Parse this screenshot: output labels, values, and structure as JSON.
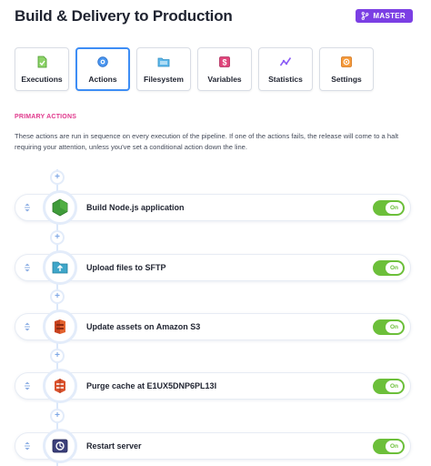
{
  "header": {
    "title": "Build & Delivery to Production",
    "branch_badge": "MASTER",
    "badge_color": "#7b3fe4"
  },
  "tabs": [
    {
      "label": "Executions",
      "icon": "executions-icon",
      "active": false
    },
    {
      "label": "Actions",
      "icon": "actions-gear-icon",
      "active": true
    },
    {
      "label": "Filesystem",
      "icon": "filesystem-icon",
      "active": false
    },
    {
      "label": "Variables",
      "icon": "variables-icon",
      "active": false
    },
    {
      "label": "Statistics",
      "icon": "statistics-icon",
      "active": false
    },
    {
      "label": "Settings",
      "icon": "settings-icon",
      "active": false
    }
  ],
  "section": {
    "label": "PRIMARY ACTIONS",
    "description": "These actions are run in sequence on every execution of the pipeline. If one of the actions fails, the release will come to a halt requiring your attention, unless you've set a conditional action down the line."
  },
  "actions": [
    {
      "name": "Build Node.js application",
      "icon": "nodejs-icon",
      "toggle": "On",
      "enabled": true
    },
    {
      "name": "Upload files to SFTP",
      "icon": "sftp-icon",
      "toggle": "On",
      "enabled": true
    },
    {
      "name": "Update assets on Amazon S3",
      "icon": "amazon-s3-icon",
      "toggle": "On",
      "enabled": true
    },
    {
      "name": "Purge cache at E1UX5DNP6PL13I",
      "icon": "cloudfront-icon",
      "toggle": "On",
      "enabled": true
    },
    {
      "name": "Restart server",
      "icon": "server-icon",
      "toggle": "On",
      "enabled": true
    }
  ],
  "colors": {
    "accent": "#3d8df5",
    "section_label": "#e0388c",
    "toggle_on": "#6cbf3a"
  }
}
